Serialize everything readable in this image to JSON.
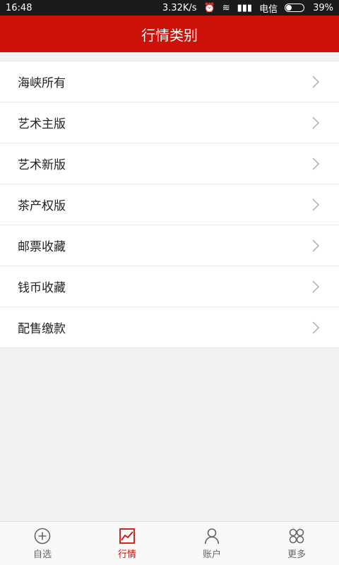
{
  "status": {
    "time": "16:48",
    "speed": "3.32K/s",
    "carrier": "电信",
    "battery": "39%"
  },
  "header": {
    "title": "行情类别"
  },
  "list": {
    "items": [
      "海峡所有",
      "艺术主版",
      "艺术新版",
      "茶产权版",
      "邮票收藏",
      "钱币收藏",
      "配售缴款"
    ]
  },
  "tabs": [
    {
      "label": "自选",
      "icon": "plus-circle-icon"
    },
    {
      "label": "行情",
      "icon": "chart-icon",
      "active": true
    },
    {
      "label": "账户",
      "icon": "user-icon"
    },
    {
      "label": "更多",
      "icon": "grid-icon"
    }
  ],
  "colors": {
    "accent": "#cc1208",
    "background": "#f2f2f4"
  }
}
